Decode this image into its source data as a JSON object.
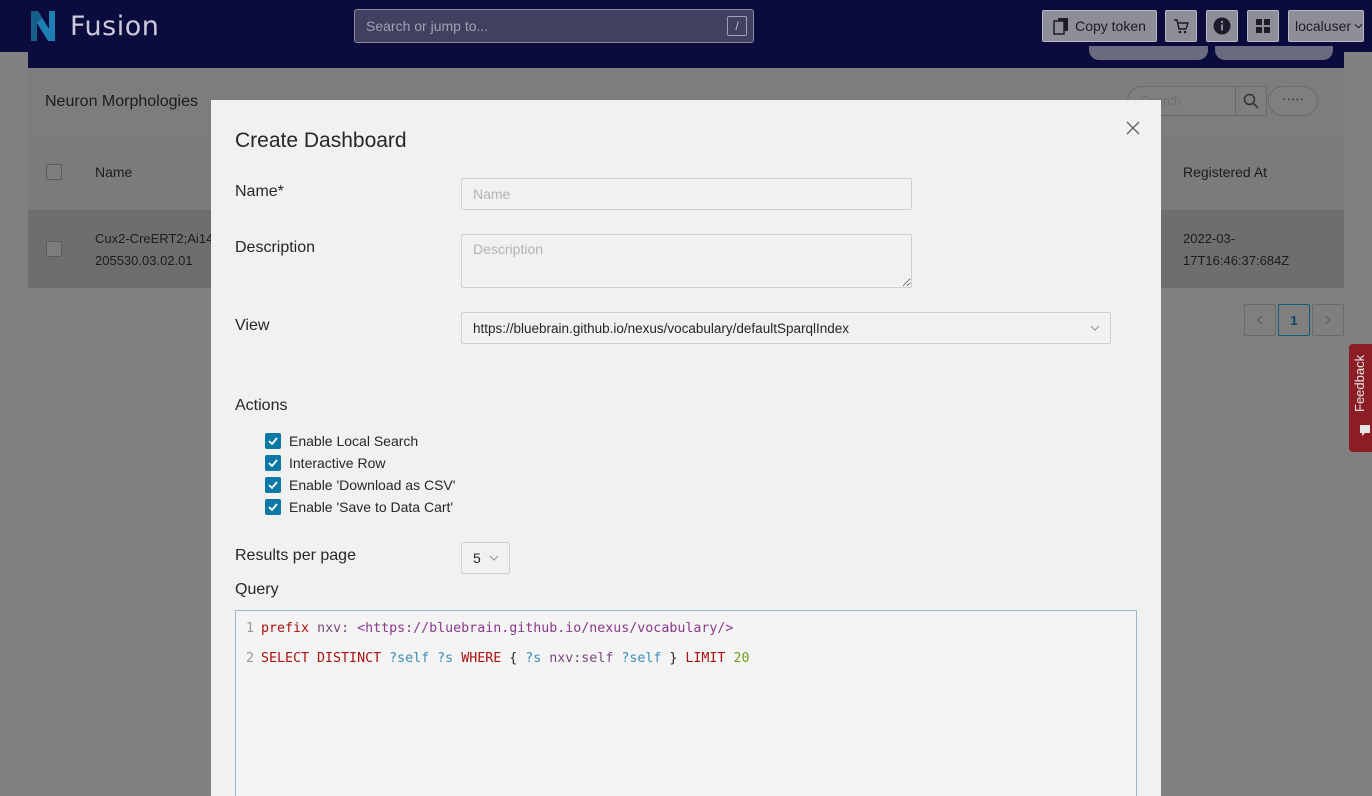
{
  "topbar": {
    "app_name": "Fusion",
    "search_placeholder": "Search or jump to...",
    "search_shortcut": "/",
    "copy_token_label": "Copy token",
    "user_label": "localuser",
    "brand_color": "#0b0b3e",
    "logo_color": "#1e7fb2"
  },
  "background_page": {
    "title": "Neuron Morphologies",
    "search_placeholder": "Search",
    "more_label": "·····",
    "columns": [
      "Name",
      "Registered At"
    ],
    "rows": [
      {
        "name_line1": "Cux2-CreERT2;Ai14",
        "name_line2": "205530.03.02.01",
        "registered_line1": "2022-03-",
        "registered_line2": "17T16:46:37:684Z"
      }
    ],
    "pagination": {
      "prev": "<",
      "current": "1",
      "next": ">"
    },
    "feedback_label": "Feedback"
  },
  "modal": {
    "title": "Create Dashboard",
    "name_label": "Name*",
    "name_placeholder": "Name",
    "name_value": "",
    "description_label": "Description",
    "description_placeholder": "Description",
    "view_label": "View",
    "view_value": "https://bluebrain.github.io/nexus/vocabulary/defaultSparqlIndex",
    "actions_label": "Actions",
    "actions": [
      {
        "label": "Enable Local Search",
        "checked": true
      },
      {
        "label": "Interactive Row",
        "checked": true
      },
      {
        "label": "Enable 'Download as CSV'",
        "checked": true
      },
      {
        "label": "Enable 'Save to Data Cart'",
        "checked": true
      }
    ],
    "results_per_page_label": "Results per page",
    "results_per_page_value": "5",
    "query_label": "Query",
    "query_lines": [
      {
        "num": "1",
        "tokens": [
          {
            "t": "prefix",
            "c": "kw"
          },
          {
            "t": " ",
            "c": "plain"
          },
          {
            "t": "nxv:",
            "c": "pfx"
          },
          {
            "t": " ",
            "c": "plain"
          },
          {
            "t": "<https://bluebrain.github.io/nexus/vocabulary/>",
            "c": "iri"
          }
        ]
      },
      {
        "num": "2",
        "tokens": [
          {
            "t": "SELECT DISTINCT",
            "c": "kw"
          },
          {
            "t": " ",
            "c": "plain"
          },
          {
            "t": "?self",
            "c": "var2"
          },
          {
            "t": " ",
            "c": "plain"
          },
          {
            "t": "?s",
            "c": "var2"
          },
          {
            "t": " ",
            "c": "plain"
          },
          {
            "t": "WHERE",
            "c": "kw"
          },
          {
            "t": " { ",
            "c": "plain"
          },
          {
            "t": "?s",
            "c": "var2"
          },
          {
            "t": " ",
            "c": "plain"
          },
          {
            "t": "nxv:self",
            "c": "pfx"
          },
          {
            "t": " ",
            "c": "plain"
          },
          {
            "t": "?self",
            "c": "var2"
          },
          {
            "t": " } ",
            "c": "plain"
          },
          {
            "t": "LIMIT",
            "c": "kw"
          },
          {
            "t": " ",
            "c": "plain"
          },
          {
            "t": "20",
            "c": "num"
          }
        ]
      }
    ],
    "checkbox_color": "#0b78a6"
  }
}
